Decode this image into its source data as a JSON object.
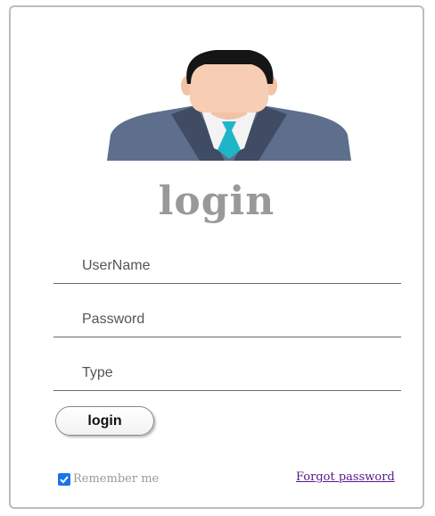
{
  "login_form": {
    "title": "login",
    "fields": [
      {
        "placeholder": "UserName",
        "value": ""
      },
      {
        "placeholder": "Password",
        "value": ""
      },
      {
        "placeholder": "Type",
        "value": ""
      }
    ],
    "login_button": "login",
    "remember": {
      "label": "Remember me",
      "checked": true
    },
    "forgot_link": "Forgot password"
  },
  "avatar": {
    "icon": "user-avatar-icon"
  },
  "colors": {
    "title": "#999999",
    "checkbox": "#1a73e8",
    "link": "#551a8b",
    "suit": "#5d6f8c",
    "tie": "#1fb5c9"
  }
}
